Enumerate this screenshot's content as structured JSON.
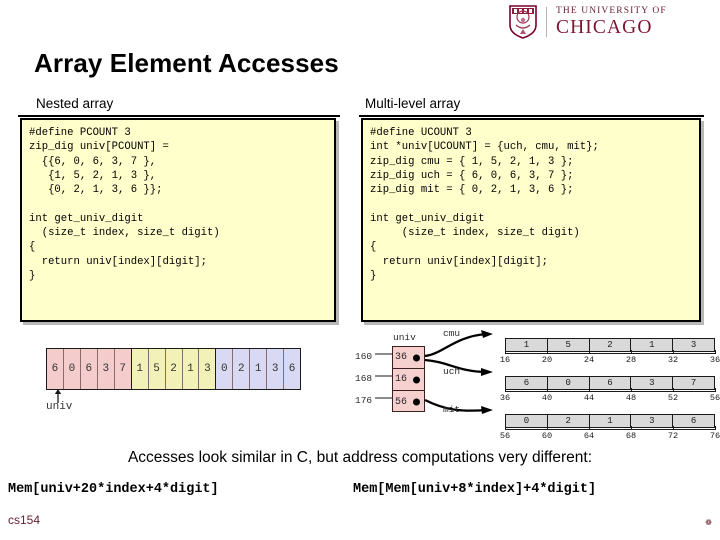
{
  "logo": {
    "line1": "THE UNIVERSITY OF",
    "line2": "CHICAGO",
    "shield_icon": "uchicago-shield-icon",
    "color": "#7a002e"
  },
  "title": "Array Element Accesses",
  "columns": {
    "left_header": "Nested array",
    "right_header": "Multi-level array"
  },
  "code": {
    "left": "#define PCOUNT 3\nzip_dig univ[PCOUNT] =\n  {{6, 0, 6, 3, 7 },\n   {1, 5, 2, 1, 3 },\n   {0, 2, 1, 3, 6 }};\n\nint get_univ_digit\n  (size_t index, size_t digit)\n{\n  return univ[index][digit];\n}",
    "right": "#define UCOUNT 3\nint *univ[UCOUNT] = {uch, cmu, mit};\nzip_dig cmu = { 1, 5, 2, 1, 3 };\nzip_dig uch = { 6, 0, 6, 3, 7 };\nzip_dig mit = { 0, 2, 1, 3, 6 };\n\nint get_univ_digit\n     (size_t index, size_t digit)\n{\n  return univ[index][digit];\n}",
    "background": "#ffffcc",
    "border": "#000000"
  },
  "diagram_left": {
    "pointer_label": "univ",
    "groups": [
      {
        "color": "#f4cccc",
        "values": [
          "6",
          "0",
          "6",
          "3",
          "7"
        ]
      },
      {
        "color": "#f2f2b8",
        "values": [
          "1",
          "5",
          "2",
          "1",
          "3"
        ]
      },
      {
        "color": "#d9d9f3",
        "values": [
          "0",
          "2",
          "1",
          "3",
          "6"
        ]
      }
    ]
  },
  "diagram_right": {
    "pointer_array_name": "univ",
    "pointer_addresses": [
      "160",
      "168",
      "176"
    ],
    "pointer_values": [
      "36",
      "16",
      "56"
    ],
    "rows": [
      {
        "name": "cmu",
        "values": [
          "1",
          "5",
          "2",
          "1",
          "3"
        ],
        "ticks": [
          "16",
          "20",
          "24",
          "28",
          "32",
          "36"
        ]
      },
      {
        "name": "uch",
        "values": [
          "6",
          "0",
          "6",
          "3",
          "7"
        ],
        "ticks": [
          "36",
          "40",
          "44",
          "48",
          "52",
          "56"
        ]
      },
      {
        "name": "mit",
        "values": [
          "0",
          "2",
          "1",
          "3",
          "6"
        ],
        "ticks": [
          "56",
          "60",
          "64",
          "68",
          "72",
          "76"
        ]
      }
    ]
  },
  "footer": {
    "summary": "Accesses look similar in C, but address computations very different:",
    "mem_expr_left": "Mem[univ+20*index+4*digit]",
    "mem_expr_right": "Mem[Mem[univ+8*index]+4*digit]",
    "course_tag": "cs154",
    "page_num": "❁"
  }
}
